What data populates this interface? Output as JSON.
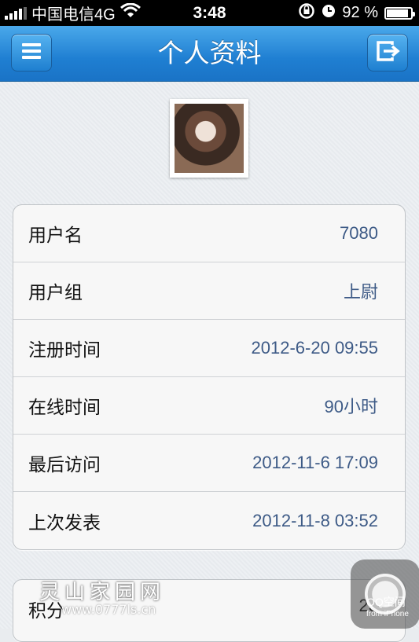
{
  "status_bar": {
    "carrier": "中国电信4G",
    "time": "3:48",
    "battery_text": "92 %",
    "battery_level": 0.92
  },
  "nav": {
    "title": "个人资料"
  },
  "profile": {
    "rows": [
      {
        "label": "用户名",
        "value": "7080"
      },
      {
        "label": "用户组",
        "value": "上尉"
      },
      {
        "label": "注册时间",
        "value": "2012-6-20 09:55"
      },
      {
        "label": "在线时间",
        "value": "90小时"
      },
      {
        "label": "最后访问",
        "value": "2012-11-6 17:09"
      },
      {
        "label": "上次发表",
        "value": "2012-11-8 03:52"
      }
    ]
  },
  "points": {
    "label": "积分",
    "value": "23"
  },
  "overlay": {
    "watermark_title": "灵山家园网",
    "watermark_url": "www.0777ls.cn",
    "qq_label": "QQ空间",
    "qq_sub": "from iPhone"
  },
  "colors": {
    "nav_blue": "#1f7fd2",
    "value_text": "#3d5a86"
  }
}
